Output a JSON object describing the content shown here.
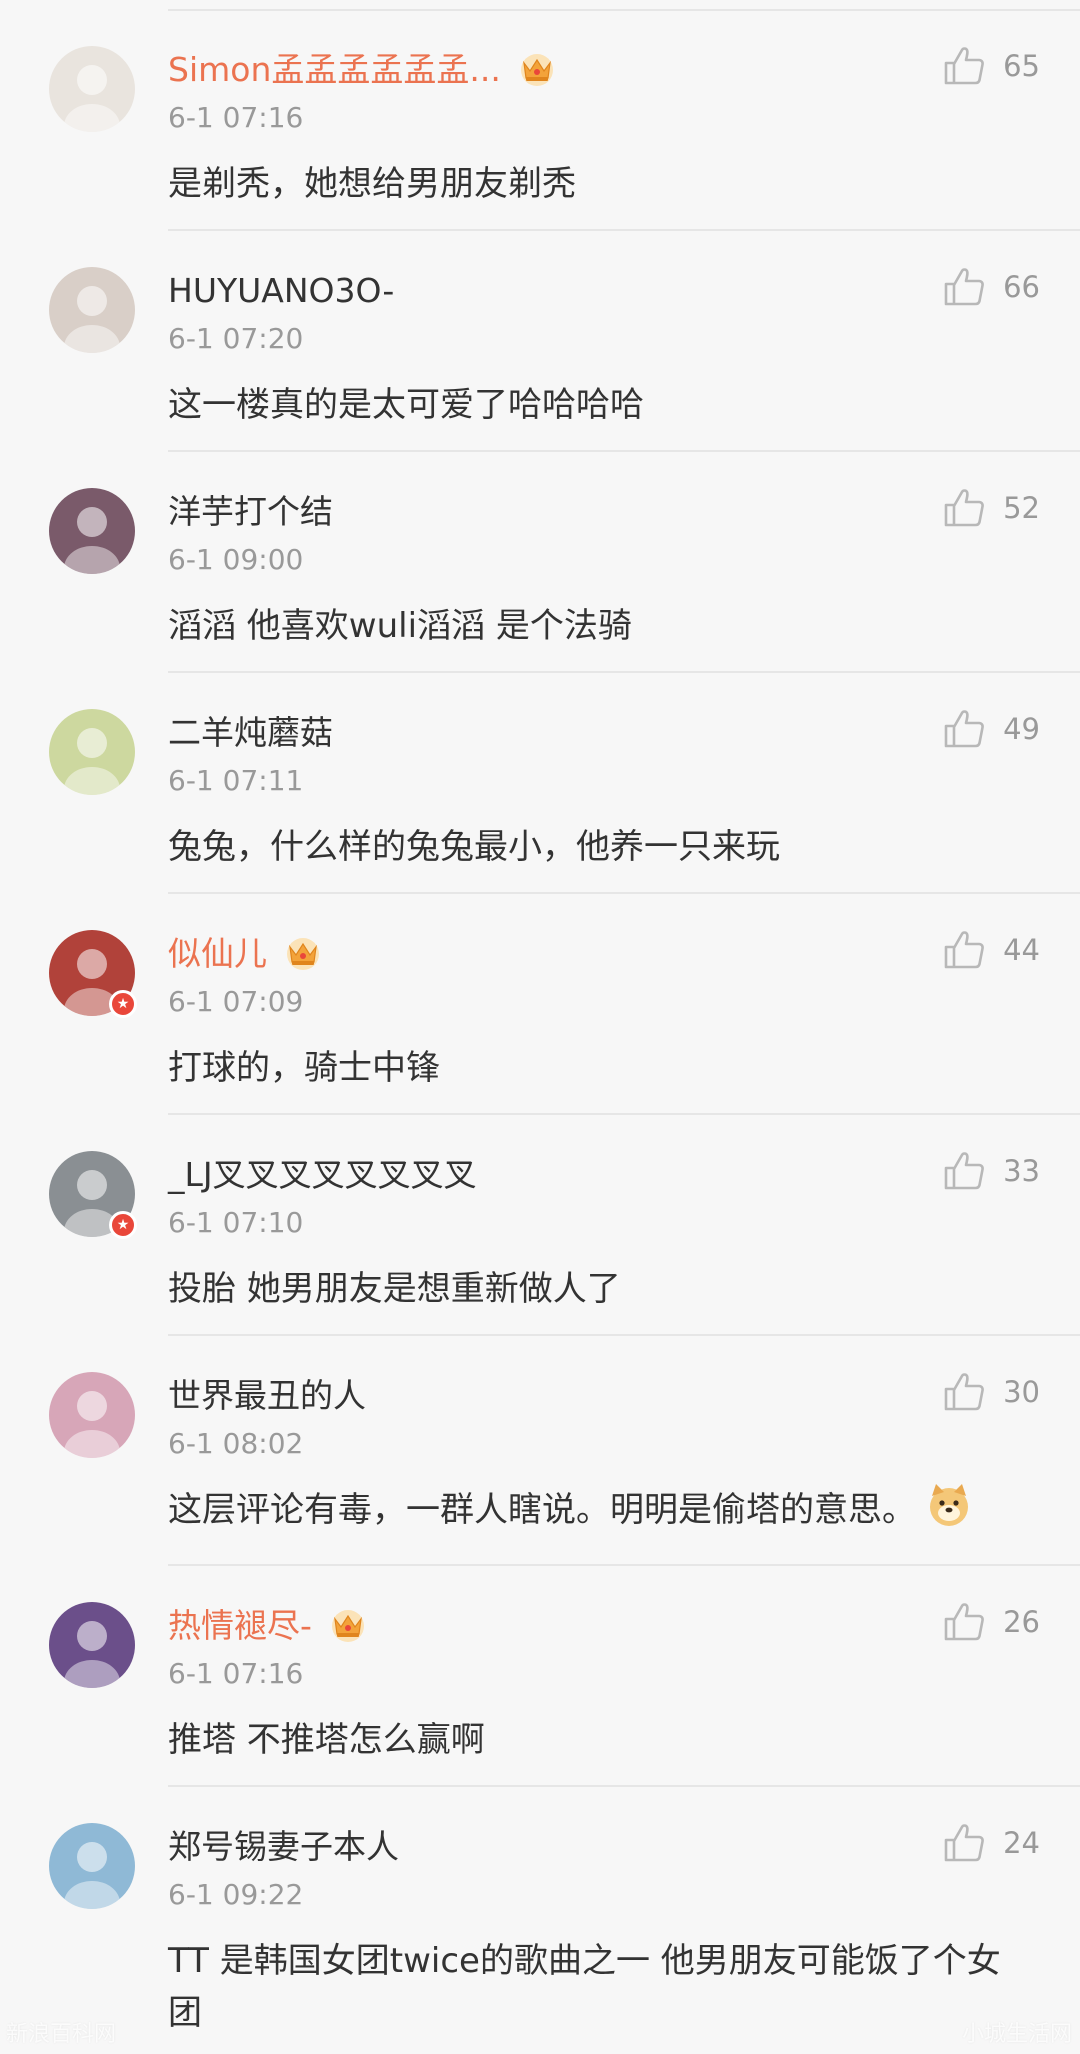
{
  "comments": [
    {
      "username": "Simon孟孟孟孟孟孟...",
      "vip": true,
      "time": "6-1 07:16",
      "likes": "65",
      "text": "是剃秃，她想给男朋友剃秃",
      "avatar_color": "#e9e4de",
      "avatar_badge": false
    },
    {
      "username": "HUYUANO3O-",
      "vip": false,
      "time": "6-1 07:20",
      "likes": "66",
      "text": "这一楼真的是太可爱了哈哈哈哈",
      "avatar_color": "#d9cfc8",
      "avatar_badge": false
    },
    {
      "username": "洋芋打个结",
      "vip": false,
      "time": "6-1 09:00",
      "likes": "52",
      "text": "滔滔 他喜欢wuli滔滔 是个法骑",
      "avatar_color": "#7a5a6a",
      "avatar_badge": false
    },
    {
      "username": "二羊炖蘑菇",
      "vip": false,
      "time": "6-1 07:11",
      "likes": "49",
      "text": "兔兔，什么样的兔兔最小，他养一只来玩",
      "avatar_color": "#cdd89f",
      "avatar_badge": false
    },
    {
      "username": "似仙儿",
      "vip": true,
      "time": "6-1 07:09",
      "likes": "44",
      "text": "打球的，骑士中锋",
      "avatar_color": "#b1423a",
      "avatar_badge": true
    },
    {
      "username": "_LJ叉叉叉叉叉叉叉叉",
      "vip": false,
      "time": "6-1 07:10",
      "likes": "33",
      "text": "投胎   她男朋友是想重新做人了",
      "avatar_color": "#8a8f93",
      "avatar_badge": true
    },
    {
      "username": "世界最丑的人",
      "vip": false,
      "time": "6-1 08:02",
      "likes": "30",
      "text": "这层评论有毒，一群人瞎说。明明是偷塔的意思。",
      "avatar_color": "#d7a6b8",
      "avatar_badge": false,
      "emoji": "doge-emoji"
    },
    {
      "username": "热情褪尽-",
      "vip": true,
      "time": "6-1 07:16",
      "likes": "26",
      "text": "推塔 不推塔怎么赢啊",
      "avatar_color": "#6b4f8a",
      "avatar_badge": false
    },
    {
      "username": "郑号锡妻子本人",
      "vip": false,
      "time": "6-1 09:22",
      "likes": "24",
      "text": "TT 是韩国女团twice的歌曲之一 他男朋友可能饭了个女团",
      "avatar_color": "#8fb9d6",
      "avatar_badge": false
    }
  ],
  "watermark": {
    "left": "新浪百科网",
    "right": "小城生活网"
  },
  "colors": {
    "vip_name": "#eb7350",
    "name": "#333333",
    "meta": "#999999",
    "divider": "#e6e6e6"
  },
  "icons": {
    "like": "thumbs-up-icon",
    "vip": "crown-icon",
    "badge": "weibo-badge-icon"
  }
}
